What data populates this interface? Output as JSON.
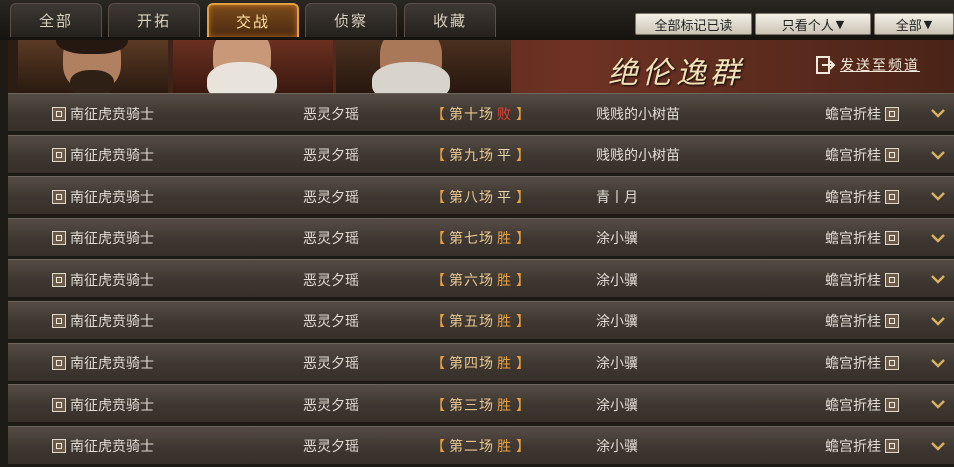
{
  "tabs": [
    {
      "label": "全部"
    },
    {
      "label": "开拓"
    },
    {
      "label": "交战"
    },
    {
      "label": "侦察"
    },
    {
      "label": "收藏"
    }
  ],
  "toolbar": {
    "mark_all_read": "全部标记已读",
    "filter_view": "只看个人",
    "filter_type": "全部",
    "dropdown_glyph": "▼"
  },
  "banner": {
    "title": "绝伦逸群",
    "send_label": "发送至频道"
  },
  "rows": [
    {
      "attacker": "南征虎贲骑士",
      "member": "恶灵夕瑶",
      "battle": "第十场",
      "result": "败",
      "opponent": "贱贱的小树苗",
      "defender": "蟾宫折桂"
    },
    {
      "attacker": "南征虎贲骑士",
      "member": "恶灵夕瑶",
      "battle": "第九场",
      "result": "平",
      "opponent": "贱贱的小树苗",
      "defender": "蟾宫折桂"
    },
    {
      "attacker": "南征虎贲骑士",
      "member": "恶灵夕瑶",
      "battle": "第八场",
      "result": "平",
      "opponent": "青丨月",
      "defender": "蟾宫折桂"
    },
    {
      "attacker": "南征虎贲骑士",
      "member": "恶灵夕瑶",
      "battle": "第七场",
      "result": "胜",
      "opponent": "涂小骥",
      "defender": "蟾宫折桂"
    },
    {
      "attacker": "南征虎贲骑士",
      "member": "恶灵夕瑶",
      "battle": "第六场",
      "result": "胜",
      "opponent": "涂小骥",
      "defender": "蟾宫折桂"
    },
    {
      "attacker": "南征虎贲骑士",
      "member": "恶灵夕瑶",
      "battle": "第五场",
      "result": "胜",
      "opponent": "涂小骥",
      "defender": "蟾宫折桂"
    },
    {
      "attacker": "南征虎贲骑士",
      "member": "恶灵夕瑶",
      "battle": "第四场",
      "result": "胜",
      "opponent": "涂小骥",
      "defender": "蟾宫折桂"
    },
    {
      "attacker": "南征虎贲骑士",
      "member": "恶灵夕瑶",
      "battle": "第三场",
      "result": "胜",
      "opponent": "涂小骥",
      "defender": "蟾宫折桂"
    },
    {
      "attacker": "南征虎贲骑士",
      "member": "恶灵夕瑶",
      "battle": "第二场",
      "result": "胜",
      "opponent": "涂小骥",
      "defender": "蟾宫折桂"
    }
  ],
  "brackets": {
    "open": "【",
    "close": "】"
  },
  "result_colors": {
    "败": "#e04030",
    "平": "#e8d8b0",
    "胜": "#e8a040"
  },
  "icons": {
    "row_badge": "faction-badge-icon",
    "expand": "chevron-down-icon",
    "send": "send-arrow-icon"
  }
}
